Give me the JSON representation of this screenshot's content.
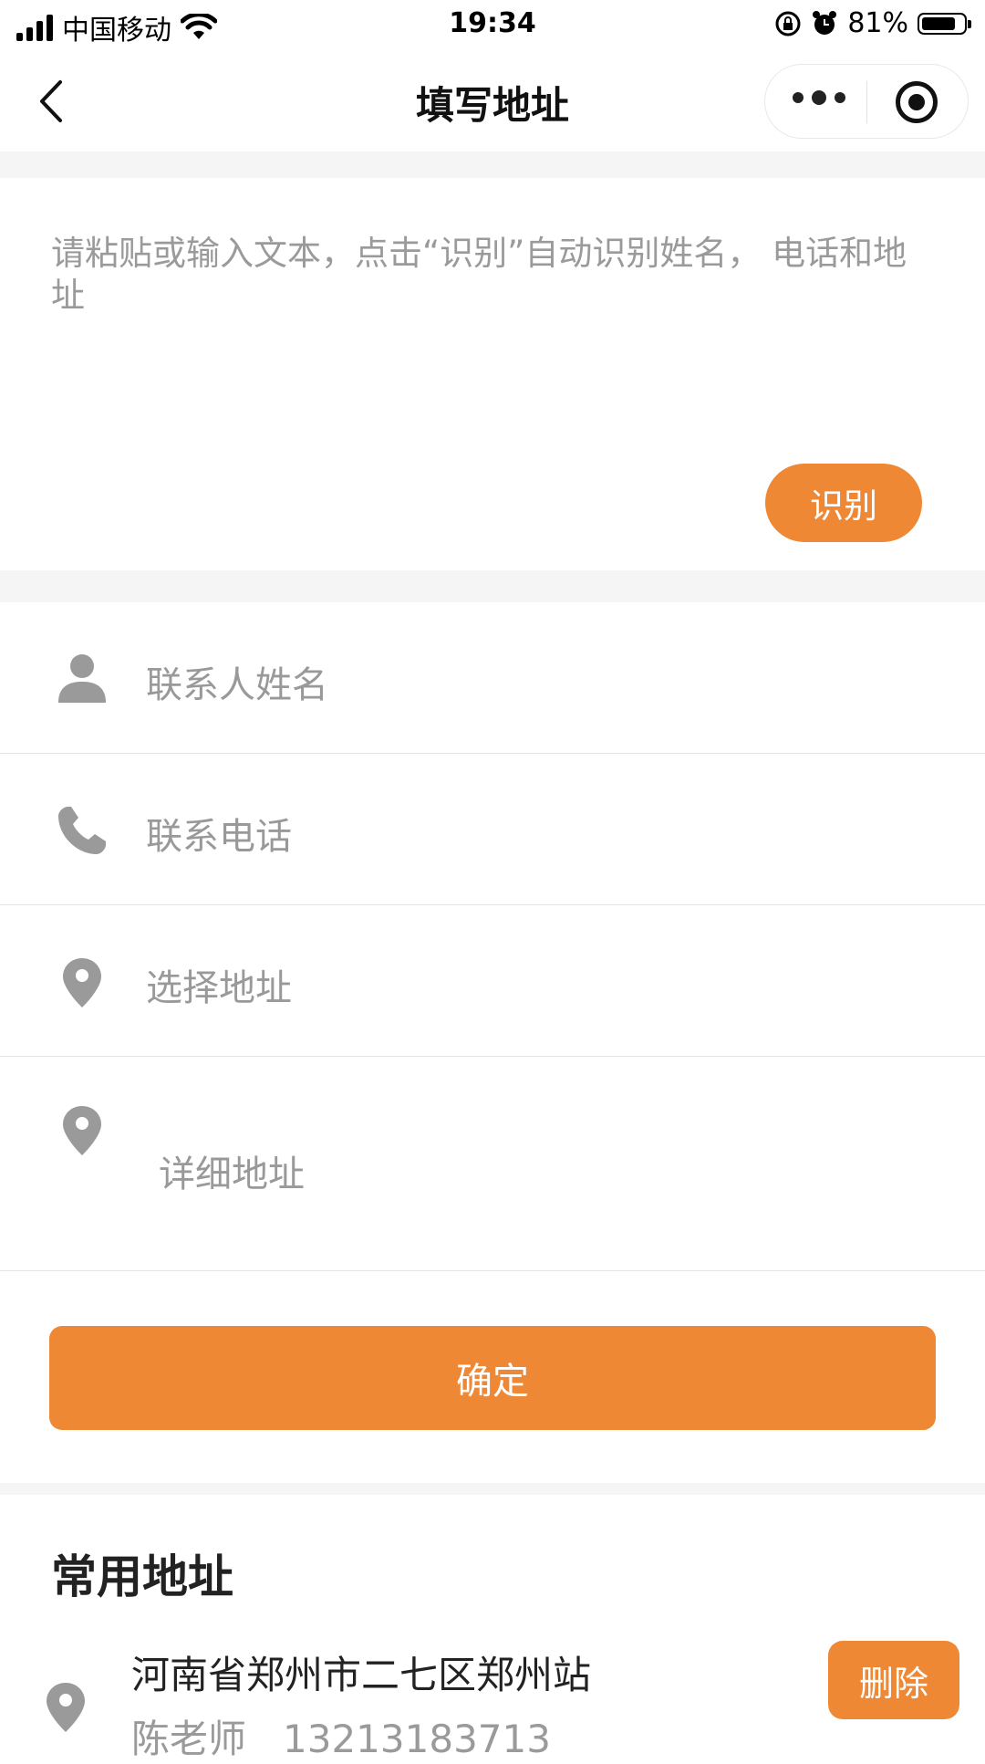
{
  "status_bar": {
    "carrier": "中国移动",
    "time": "19:34",
    "battery_percent": "81%",
    "battery_level": 0.81,
    "icons": [
      "signal-icon",
      "wifi-icon",
      "orientation-lock-icon",
      "alarm-icon",
      "battery-icon"
    ]
  },
  "nav": {
    "title": "填写地址",
    "back_icon": "chevron-left-icon",
    "more_icon": "more-dots-icon",
    "close_icon": "target-icon"
  },
  "paste_area": {
    "placeholder": "请粘贴或输入文本，点击“识别”自动识别姓名， 电话和地址",
    "recognize_label": "识别"
  },
  "form": {
    "name_placeholder": "联系人姓名",
    "phone_placeholder": "联系电话",
    "address_placeholder": "选择地址",
    "detail_placeholder": "详细地址"
  },
  "confirm_label": "确定",
  "common": {
    "title": "常用地址",
    "items": [
      {
        "address": "河南省郑州市二七区郑州站",
        "name": "陈老师",
        "phone": "13213183713",
        "delete_label": "删除"
      }
    ]
  },
  "colors": {
    "accent": "#ee8835",
    "placeholder": "#999999",
    "divider": "#e5e5e5",
    "section_gap": "#f5f5f5"
  }
}
